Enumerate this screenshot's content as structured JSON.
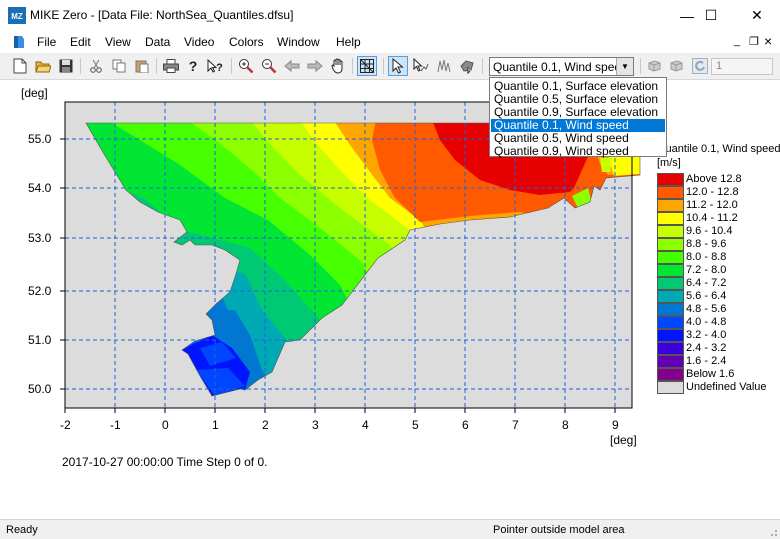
{
  "window": {
    "title": "MIKE Zero - [Data File: NorthSea_Quantiles.dfsu]",
    "min_glyph": "—",
    "max_glyph": "☐",
    "close_glyph": "✕"
  },
  "menu": {
    "items": [
      "File",
      "Edit",
      "View",
      "Data",
      "Video",
      "Colors",
      "Window",
      "Help"
    ],
    "mdi_minimize": "_",
    "mdi_restore": "❐",
    "mdi_close": "×"
  },
  "toolbar": {
    "item_selector_value": "Quantile 0.1, Wind speed",
    "item_options": [
      "Quantile 0.1, Surface elevation",
      "Quantile 0.5, Surface elevation",
      "Quantile 0.9, Surface elevation",
      "Quantile 0.1, Wind speed",
      "Quantile 0.5, Wind speed",
      "Quantile 0.9, Wind speed"
    ],
    "selected_option_index": 3,
    "time_step_value": "1"
  },
  "plot": {
    "y_unit": "[deg]",
    "x_unit": "[deg]",
    "y_ticks": [
      "55.0",
      "54.0",
      "53.0",
      "52.0",
      "51.0",
      "50.0"
    ],
    "x_ticks": [
      "-2",
      "-1",
      "0",
      "1",
      "2",
      "3",
      "4",
      "5",
      "6",
      "7",
      "8",
      "9"
    ],
    "timestamp": "2017-10-27 00:00:00  Time Step 0 of 0."
  },
  "legend": {
    "title": "Quantile 0.1, Wind speed",
    "unit": "[m/s]",
    "entries": [
      {
        "label": "Above 12.8",
        "color": "#e60000"
      },
      {
        "label": "12.0 - 12.8",
        "color": "#ff5a00"
      },
      {
        "label": "11.2 - 12.0",
        "color": "#ffa500"
      },
      {
        "label": "10.4 - 11.2",
        "color": "#ffff00"
      },
      {
        "label": "9.6 - 10.4",
        "color": "#c8ff00"
      },
      {
        "label": "8.8 -  9.6",
        "color": "#8cff00"
      },
      {
        "label": "8.0 -  8.8",
        "color": "#46ff00"
      },
      {
        "label": "7.2 -  8.0",
        "color": "#00e632"
      },
      {
        "label": "6.4 -  7.2",
        "color": "#00c873"
      },
      {
        "label": "5.6 -  6.4",
        "color": "#00aab4"
      },
      {
        "label": "4.8 -  5.6",
        "color": "#0078d2"
      },
      {
        "label": "4.0 -  4.8",
        "color": "#0046ff"
      },
      {
        "label": "3.2 -  4.0",
        "color": "#0014ff"
      },
      {
        "label": "2.4 -  3.2",
        "color": "#3c00dc"
      },
      {
        "label": "1.6 -  2.4",
        "color": "#6400b4"
      },
      {
        "label": "Below   1.6",
        "color": "#82008c"
      },
      {
        "label": "Undefined Value",
        "color": "#dcdcdc"
      }
    ]
  },
  "status": {
    "left": "Ready",
    "right": "Pointer outside model area"
  }
}
